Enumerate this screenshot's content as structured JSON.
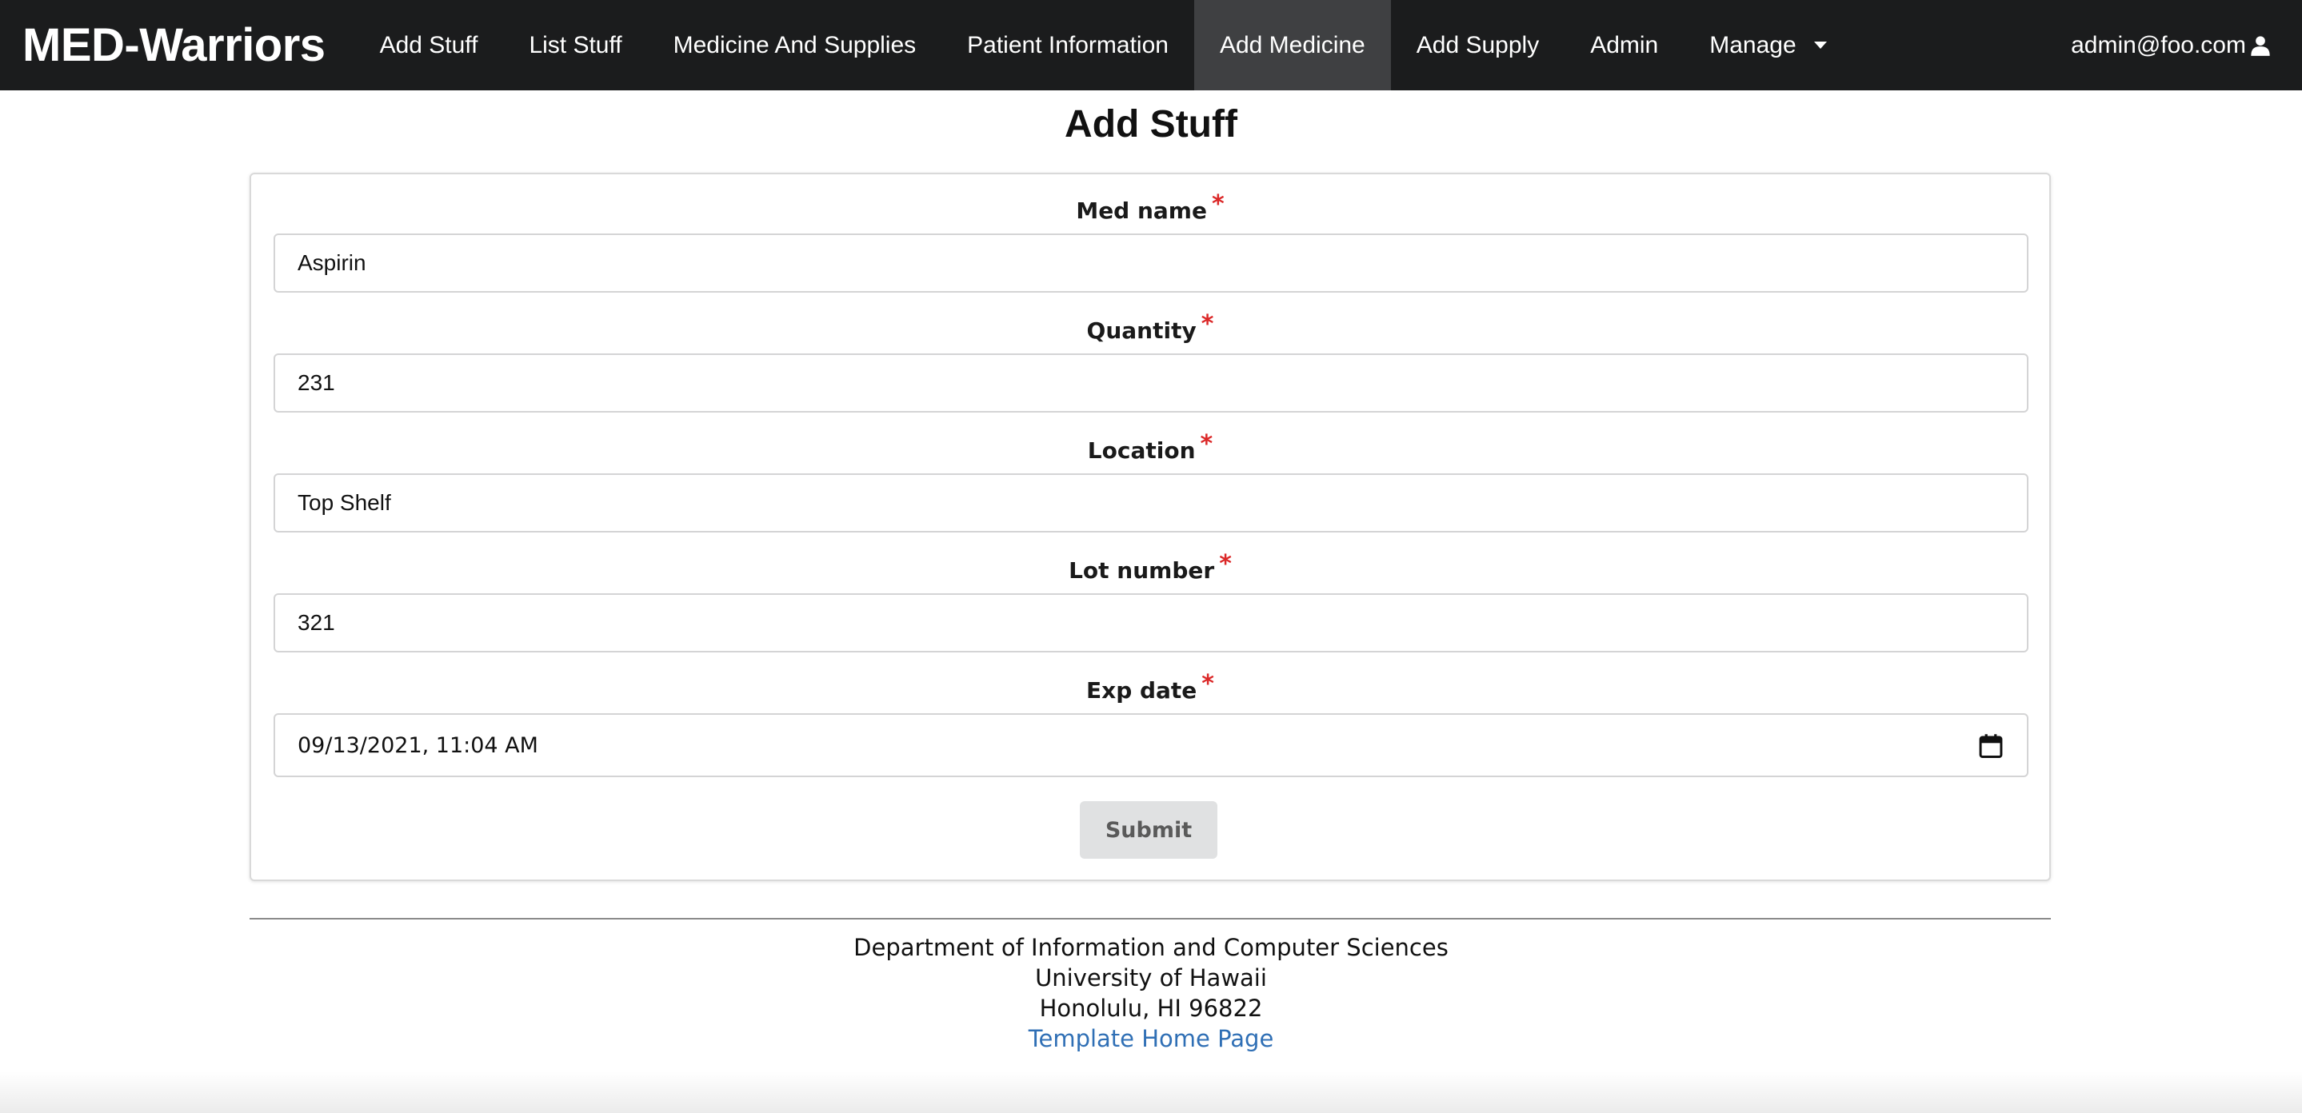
{
  "navbar": {
    "brand": "MED-Warriors",
    "items": [
      {
        "label": "Add Stuff"
      },
      {
        "label": "List Stuff"
      },
      {
        "label": "Medicine And Supplies"
      },
      {
        "label": "Patient Information"
      },
      {
        "label": "Add Medicine",
        "active": true
      },
      {
        "label": "Add Supply"
      },
      {
        "label": "Admin"
      },
      {
        "label": "Manage"
      }
    ],
    "user": "admin@foo.com",
    "user_icon": "user-icon"
  },
  "page": {
    "title": "Add Stuff"
  },
  "form": {
    "fields": [
      {
        "label": "Med name",
        "required_mark": "*",
        "value": "Aspirin"
      },
      {
        "label": "Quantity",
        "required_mark": "*",
        "value": "231"
      },
      {
        "label": "Location",
        "required_mark": "*",
        "value": "Top Shelf"
      },
      {
        "label": "Lot number",
        "required_mark": "*",
        "value": "321"
      },
      {
        "label": "Exp date",
        "required_mark": "*",
        "value": "09/13/2021, 11:04 AM"
      }
    ],
    "submit_label": "Submit"
  },
  "footer": {
    "line1": "Department of Information and Computer Sciences",
    "line2": "University of Hawaii",
    "line3": "Honolulu, HI 96822",
    "link": "Template Home Page"
  },
  "colors": {
    "navbar_bg": "#1b1c1d",
    "active_item_bg": "#3f4042",
    "required": "#db2828",
    "link": "#2f6fb5",
    "submit_bg": "#e0e1e2"
  }
}
